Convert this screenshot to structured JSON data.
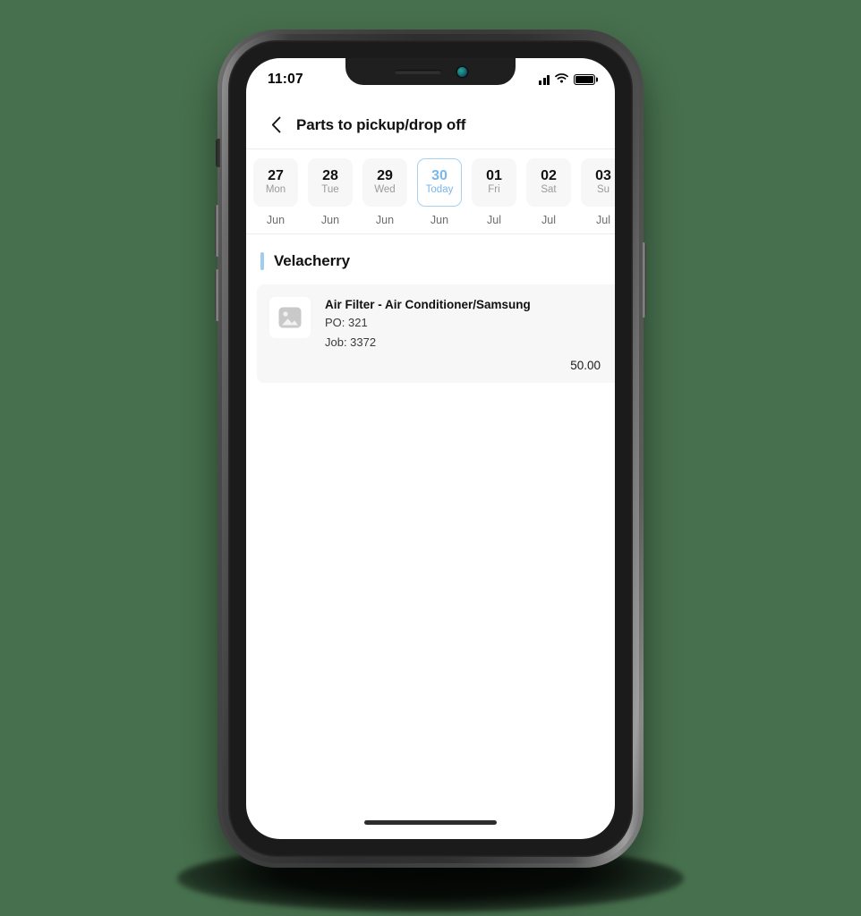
{
  "theme": {
    "page_background": "#47704e",
    "accent_blue": "#9ecdef",
    "today_blue": "#7ab6e8",
    "card_background": "#f7f7f7"
  },
  "status_bar": {
    "time": "11:07",
    "signal_icon": "signal-bars-icon",
    "wifi_icon": "wifi-icon",
    "battery_icon": "battery-full-icon"
  },
  "header": {
    "back_icon": "chevron-left-icon",
    "title": "Parts to pickup/drop off"
  },
  "date_strip": {
    "today_label": "Today",
    "dates": [
      {
        "day": "27",
        "weekday": "Mon",
        "month": "Jun",
        "selected": false
      },
      {
        "day": "28",
        "weekday": "Tue",
        "month": "Jun",
        "selected": false
      },
      {
        "day": "29",
        "weekday": "Wed",
        "month": "Jun",
        "selected": false
      },
      {
        "day": "30",
        "weekday": "Today",
        "month": "Jun",
        "selected": true
      },
      {
        "day": "01",
        "weekday": "Fri",
        "month": "Jul",
        "selected": false
      },
      {
        "day": "02",
        "weekday": "Sat",
        "month": "Jul",
        "selected": false
      },
      {
        "day": "03",
        "weekday": "Su",
        "month": "Jul",
        "selected": false
      }
    ]
  },
  "sections": [
    {
      "title": "Velacherry",
      "items": [
        {
          "thumbnail_icon": "image-placeholder-icon",
          "name": "Air Filter - Air Conditioner/Samsung",
          "po": "PO: 321",
          "job": "Job: 3372",
          "price": "50.00"
        }
      ]
    }
  ],
  "home_indicator": "home-indicator-bar"
}
